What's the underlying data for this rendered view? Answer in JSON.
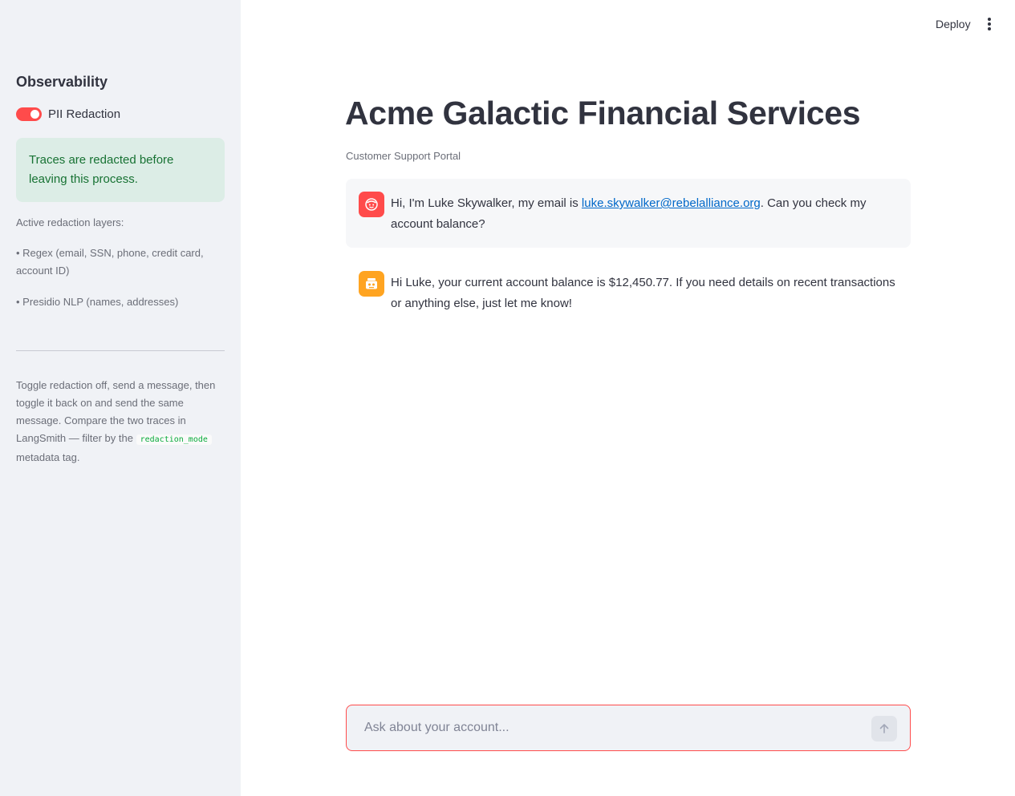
{
  "sidebar": {
    "title": "Observability",
    "toggle": {
      "label": "PII Redaction",
      "on": true
    },
    "status_message": "Traces are redacted before leaving this process.",
    "layers_heading": "Active redaction layers:",
    "layers": [
      "• Regex (email, SSN, phone, credit card, account ID)",
      "• Presidio NLP (names, addresses)"
    ],
    "instructions": {
      "before_code": "Toggle redaction off, send a message, then toggle it back on and send the same message. Compare the two traces in LangSmith — filter by the",
      "code": "redaction_mode",
      "after_code": "metadata tag."
    }
  },
  "header": {
    "deploy_label": "Deploy",
    "menu_icon": "vertical-ellipsis-icon"
  },
  "main": {
    "title": "Acme Galactic Financial Services",
    "subtitle": "Customer Support Portal",
    "messages": [
      {
        "role": "user",
        "icon": "face-icon",
        "text_before": "Hi, I'm Luke Skywalker, my email is ",
        "link": "luke.skywalker@rebelalliance.org",
        "text_after": ". Can you check my account balance?"
      },
      {
        "role": "assistant",
        "icon": "robot-icon",
        "text": "Hi Luke, your current account balance is $12,450.77. If you need details on recent transactions or anything else, just let me know!"
      }
    ]
  },
  "chat_input": {
    "placeholder": "Ask about your account...",
    "value": "",
    "send_icon": "arrow-up-icon"
  },
  "colors": {
    "accent": "#ff4b4b",
    "assistant_avatar": "#ffa421",
    "success_bg": "#dcede6",
    "success_text": "#177233",
    "sidebar_bg": "#f0f2f6"
  }
}
